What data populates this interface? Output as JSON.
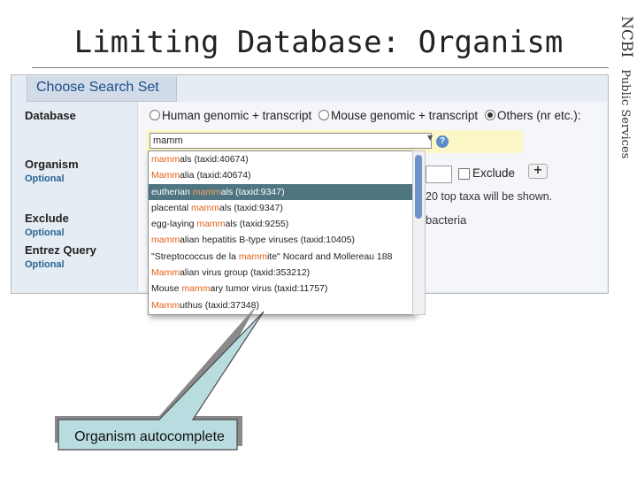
{
  "slide": {
    "title": "Limiting Database: Organism",
    "side_brand": "NCBI",
    "side_label": "Public Services"
  },
  "form": {
    "tab_label": "Choose Search Set",
    "database_label": "Database",
    "database_options": [
      {
        "label": "Human genomic + transcript",
        "selected": false
      },
      {
        "label": "Mouse genomic + transcript",
        "selected": false
      },
      {
        "label": "Others (nr etc.):",
        "selected": true
      }
    ],
    "organism_label": "Organism",
    "organism_optional": "Optional",
    "organism_value": "mamm",
    "exclude_label": "Exclude",
    "exclude_optional": "Optional",
    "entrez_label": "Entrez Query",
    "entrez_optional": "Optional",
    "exclude_checkbox_label": "Exclude",
    "plus_label": "+",
    "help_glyph": "?",
    "taxa_note": "20 top taxa will be shown.",
    "bacteria_text": "bacteria"
  },
  "autocomplete": [
    {
      "pre": "",
      "match": "mamm",
      "post": "als (taxid:40674)",
      "selected": false
    },
    {
      "pre": "",
      "match": "Mamm",
      "post": "alia (taxid:40674)",
      "selected": false
    },
    {
      "pre": "eutherian ",
      "match": "mamm",
      "post": "als (taxid:9347)",
      "selected": true
    },
    {
      "pre": "placental ",
      "match": "mamm",
      "post": "als (taxid:9347)",
      "selected": false
    },
    {
      "pre": "egg-laying ",
      "match": "mamm",
      "post": "als (taxid:9255)",
      "selected": false
    },
    {
      "pre": "",
      "match": "mamm",
      "post": "alian hepatitis B-type viruses (taxid:10405)",
      "selected": false
    },
    {
      "pre": "\"Streptococcus de la ",
      "match": "mamm",
      "post": "ite\" Nocard and Mollereau 188",
      "selected": false
    },
    {
      "pre": "",
      "match": "Mamm",
      "post": "alian virus group (taxid:353212)",
      "selected": false
    },
    {
      "pre": "Mouse ",
      "match": "mamm",
      "post": "ary tumor virus (taxid:11757)",
      "selected": false
    },
    {
      "pre": "",
      "match": "Mamm",
      "post": "uthus (taxid:37348)",
      "selected": false
    }
  ],
  "callout": {
    "text": "Organism autocomplete"
  },
  "colors": {
    "match_highlight": "#e25f12",
    "selected_row": "#4f7581",
    "callout_fill": "#b9dce0"
  }
}
